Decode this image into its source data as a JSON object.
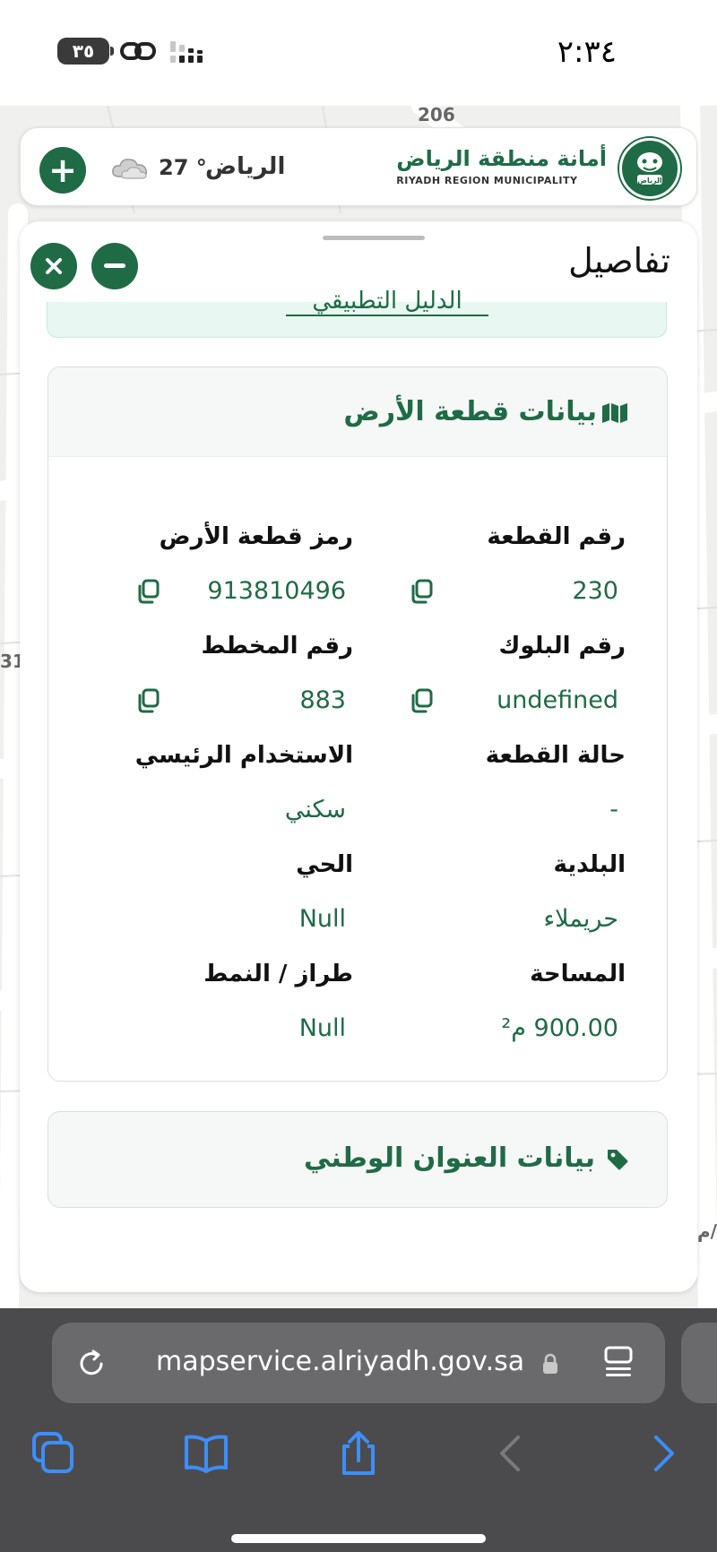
{
  "status_bar": {
    "time": "٢:٣٤",
    "battery": "٣٥"
  },
  "map": {
    "label_top": "206",
    "label_left": "31",
    "label_right": "م/"
  },
  "header": {
    "weather_city": "الرياض",
    "weather_temp": "27 °",
    "brand_name_ar": "أمانة منطقة الرياض",
    "brand_name_en": "RIYADH REGION MUNICIPALITY",
    "logo_text": "الرياض",
    "plus_label": "+"
  },
  "panel": {
    "title": "تفاصيل",
    "previous_section_text": "الدليل التطبيقي"
  },
  "land_data": {
    "title": "بيانات قطعة الأرض",
    "fields": [
      {
        "label": "رقم القطعة",
        "value": "230"
      },
      {
        "label": "رمز قطعة الأرض",
        "value": "913810496"
      },
      {
        "label": "رقم البلوك",
        "value": "undefined"
      },
      {
        "label": "رقم المخطط",
        "value": "883"
      },
      {
        "label": "حالة القطعة",
        "value": "-"
      },
      {
        "label": "الاستخدام الرئيسي",
        "value": "سكني"
      },
      {
        "label": "البلدية",
        "value": "حريملاء"
      },
      {
        "label": "الحي",
        "value": "Null"
      },
      {
        "label": "المساحة",
        "value": "900.00 م²"
      },
      {
        "label": "طراز / النمط",
        "value": "Null"
      }
    ]
  },
  "national_address": {
    "title": "بيانات العنوان الوطني"
  },
  "browser": {
    "url": "mapservice.alriyadh.gov.sa"
  },
  "colors": {
    "brand_green": "#1f6b46",
    "browser_bar": "#4b4b4d",
    "ios_blue": "#3d8ef7"
  }
}
